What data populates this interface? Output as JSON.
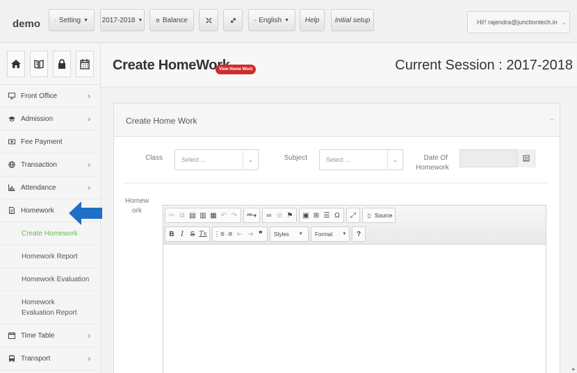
{
  "topbar": {
    "brand": "demo",
    "setting_label": "Setting",
    "session_label": "2017-2018",
    "balance_label": "Balance",
    "language_label": "English",
    "help_label": "Help",
    "initial_setup_label": "Initial setup",
    "user_label": "Hi!! rajendra@junctiontech.in"
  },
  "sidebar": {
    "quick_icons": [
      "home-icon",
      "book-icon",
      "lock-icon",
      "calendar-icon"
    ],
    "items": [
      {
        "label": "Front Office",
        "icon": "desktop-icon",
        "has_children": true
      },
      {
        "label": "Admission",
        "icon": "graduation-cap-icon",
        "has_children": true
      },
      {
        "label": "Fee Payment",
        "icon": "money-icon",
        "has_children": false
      },
      {
        "label": "Transaction",
        "icon": "globe-icon",
        "has_children": true
      },
      {
        "label": "Attendance",
        "icon": "bar-chart-icon",
        "has_children": true
      },
      {
        "label": "Homework",
        "icon": "file-icon",
        "has_children": false
      },
      {
        "label": "Time Table",
        "icon": "calendar-icon",
        "has_children": true
      },
      {
        "label": "Transport",
        "icon": "bus-icon",
        "has_children": true
      }
    ],
    "homework_sub": [
      {
        "label": "Create Homework",
        "active": true
      },
      {
        "label": "Homework Report",
        "active": false
      },
      {
        "label": "Homework Evaluation",
        "active": false
      },
      {
        "label": "Homework Evaluation Report",
        "active": false
      }
    ],
    "chevron": "›"
  },
  "header": {
    "title": "Create HomeWork",
    "view_button": "View Home Work",
    "session_text": "Current Session : 2017-2018"
  },
  "panel": {
    "title": "Create Home Work",
    "collapse_symbol": "−",
    "class_label": "Class",
    "class_placeholder": "Select ...",
    "subject_label": "Subject",
    "subject_placeholder": "Select ...",
    "date_label": "Date Of Homework",
    "homework_label": "Homework"
  },
  "editor": {
    "source_label": "Source",
    "styles_label": "Styles",
    "format_label": "Format",
    "help_symbol": "?"
  },
  "colors": {
    "active_submenu": "#6aba4b",
    "view_button": "#d12b2b",
    "arrow": "#1e6fc7"
  }
}
